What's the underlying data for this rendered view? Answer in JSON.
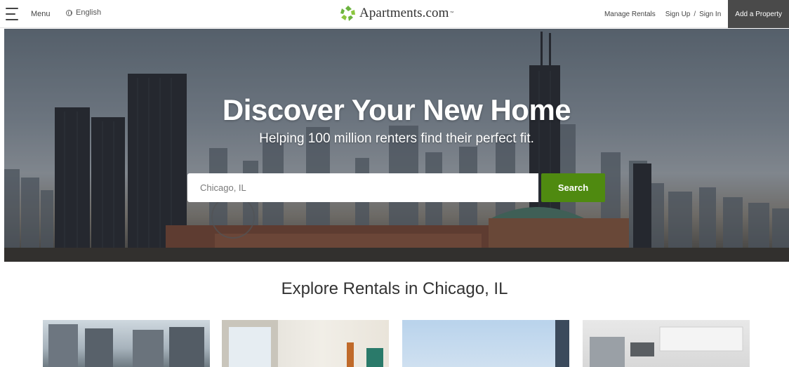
{
  "header": {
    "menu_label": "Menu",
    "language": "English",
    "logo_text": "Apartments.com",
    "logo_tm": "™",
    "manage_rentals": "Manage Rentals",
    "sign_up": "Sign Up",
    "separator": "/",
    "sign_in": "Sign In",
    "add_property": "Add a Property"
  },
  "hero": {
    "title": "Discover Your New Home",
    "subtitle": "Helping 100 million renters find their perfect fit.",
    "search_placeholder": "Chicago, IL",
    "search_button": "Search"
  },
  "explore": {
    "title": "Explore Rentals in Chicago, IL"
  },
  "icons": {
    "menu": "hamburger-icon",
    "language": "globe-icon",
    "logo": "apartments-logo-icon"
  },
  "colors": {
    "search_button": "#4f8a10",
    "add_property_bg": "#4a4a4a",
    "logo_green": "#6cb33f"
  }
}
